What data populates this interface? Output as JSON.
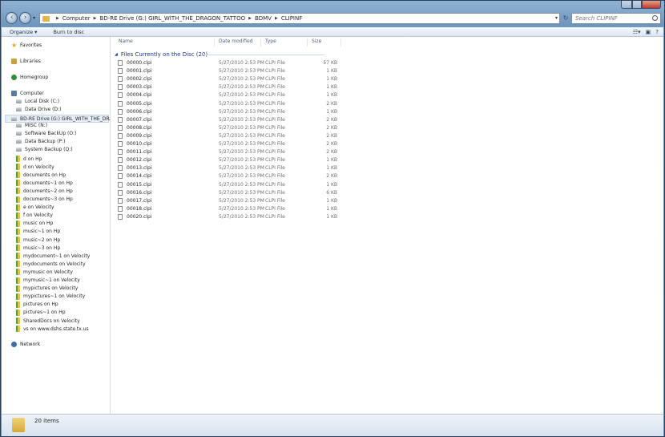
{
  "address": {
    "crumbs": [
      "Computer",
      "BD-RE Drive (G:) GIRL_WITH_THE_DRAGON_TATTOO",
      "BDMV",
      "CLIPINF"
    ]
  },
  "search": {
    "placeholder": "Search CLIPINF"
  },
  "toolbar": {
    "organize": "Organize ▾",
    "burn": "Burn to disc"
  },
  "nav": {
    "favorites": "Favorites",
    "libraries": "Libraries",
    "homegroup": "Homegroup",
    "computer": "Computer",
    "drives": [
      "Local Disk (C:)",
      "Data Drive (D:)",
      "BD-RE Drive (G:) GIRL_WITH_THE_DRAGON",
      "MISC (N:)",
      "Software BackUp (O:)",
      "Data Backup (P:)",
      "System Backup (Q:)"
    ],
    "shares": [
      "d on Hp",
      "d on Velocity",
      "documents on Hp",
      "documents~1 on Hp",
      "documents~2 on Hp",
      "documents~3 on Hp",
      "e on Velocity",
      "f on Velocity",
      "music on Hp",
      "music~1 on Hp",
      "music~2 on Hp",
      "music~3 on Hp",
      "mydocument~1 on Velocity",
      "mydocuments on Velocity",
      "mymusic on Velocity",
      "mymusic~1 on Velocity",
      "mypictures on Velocity",
      "mypictures~1 on Velocity",
      "pictures on Hp",
      "pictures~1 on Hp",
      "SharedDocs on Velocity",
      "vs on www.dshs.state.tx.us"
    ],
    "network": "Network"
  },
  "columns": {
    "name": "Name",
    "date": "Date modified",
    "type": "Type",
    "size": "Size"
  },
  "group_label": "Files Currently on the Disc (20)",
  "files": [
    {
      "name": "00000.clpi",
      "date": "5/27/2010 2:53 PM",
      "type": "CLPI File",
      "size": "57 KB"
    },
    {
      "name": "00001.clpi",
      "date": "5/27/2010 2:53 PM",
      "type": "CLPI File",
      "size": "1 KB"
    },
    {
      "name": "00002.clpi",
      "date": "5/27/2010 2:53 PM",
      "type": "CLPI File",
      "size": "1 KB"
    },
    {
      "name": "00003.clpi",
      "date": "5/27/2010 2:53 PM",
      "type": "CLPI File",
      "size": "1 KB"
    },
    {
      "name": "00004.clpi",
      "date": "5/27/2010 2:53 PM",
      "type": "CLPI File",
      "size": "1 KB"
    },
    {
      "name": "00005.clpi",
      "date": "5/27/2010 2:53 PM",
      "type": "CLPI File",
      "size": "2 KB"
    },
    {
      "name": "00006.clpi",
      "date": "5/27/2010 2:53 PM",
      "type": "CLPI File",
      "size": "1 KB"
    },
    {
      "name": "00007.clpi",
      "date": "5/27/2010 2:53 PM",
      "type": "CLPI File",
      "size": "2 KB"
    },
    {
      "name": "00008.clpi",
      "date": "5/27/2010 2:53 PM",
      "type": "CLPI File",
      "size": "2 KB"
    },
    {
      "name": "00009.clpi",
      "date": "5/27/2010 2:53 PM",
      "type": "CLPI File",
      "size": "2 KB"
    },
    {
      "name": "00010.clpi",
      "date": "5/27/2010 2:53 PM",
      "type": "CLPI File",
      "size": "2 KB"
    },
    {
      "name": "00011.clpi",
      "date": "5/27/2010 2:53 PM",
      "type": "CLPI File",
      "size": "2 KB"
    },
    {
      "name": "00012.clpi",
      "date": "5/27/2010 2:53 PM",
      "type": "CLPI File",
      "size": "1 KB"
    },
    {
      "name": "00013.clpi",
      "date": "5/27/2010 2:53 PM",
      "type": "CLPI File",
      "size": "1 KB"
    },
    {
      "name": "00014.clpi",
      "date": "5/27/2010 2:53 PM",
      "type": "CLPI File",
      "size": "2 KB"
    },
    {
      "name": "00015.clpi",
      "date": "5/27/2010 2:53 PM",
      "type": "CLPI File",
      "size": "1 KB"
    },
    {
      "name": "00016.clpi",
      "date": "5/27/2010 2:53 PM",
      "type": "CLPI File",
      "size": "6 KB"
    },
    {
      "name": "00017.clpi",
      "date": "5/27/2010 2:53 PM",
      "type": "CLPI File",
      "size": "1 KB"
    },
    {
      "name": "00018.clpi",
      "date": "5/27/2010 2:53 PM",
      "type": "CLPI File",
      "size": "1 KB"
    },
    {
      "name": "00020.clpi",
      "date": "5/27/2010 2:53 PM",
      "type": "CLPI File",
      "size": "1 KB"
    }
  ],
  "status": {
    "count": "20 items"
  }
}
